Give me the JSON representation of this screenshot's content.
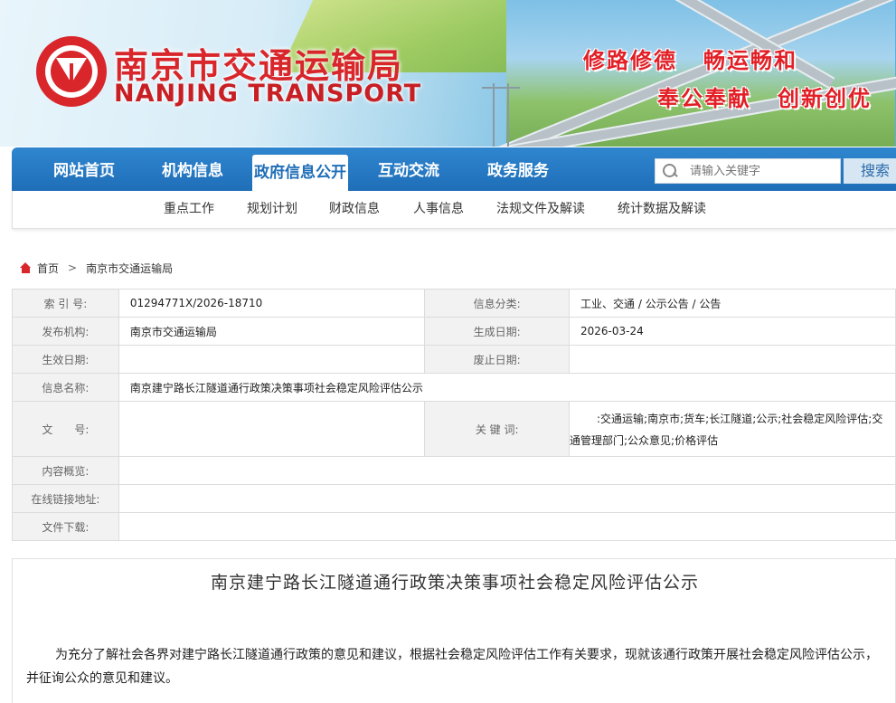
{
  "header": {
    "title_cn": "南京市交通运输局",
    "title_en": "NANJING TRANSPORT",
    "slogans": [
      "修路修德",
      "畅运畅和",
      "奉公奉献",
      "创新创优"
    ]
  },
  "nav": {
    "items": [
      "网站首页",
      "机构信息",
      "政府信息公开",
      "互动交流",
      "政务服务"
    ],
    "active_index": 2,
    "search_placeholder": "请输入关键字",
    "search_button": "搜索"
  },
  "subnav": [
    "重点工作",
    "规划计划",
    "财政信息",
    "人事信息",
    "法规文件及解读",
    "统计数据及解读"
  ],
  "breadcrumb": [
    "首页",
    "南京市交通运输局"
  ],
  "info": {
    "index_label": "索 引 号:",
    "index_value": "01294771X/2026-18710",
    "category_label": "信息分类:",
    "category_value": "工业、交通 / 公示公告 / 公告",
    "publisher_label": "发布机构:",
    "publisher_value": "南京市交通运输局",
    "created_label": "生成日期:",
    "created_value": "2026-03-24",
    "effective_label": "生效日期:",
    "effective_value": "",
    "abolish_label": "废止日期:",
    "abolish_value": "",
    "name_label": "信息名称:",
    "name_value": "南京建宁路长江隧道通行政策决策事项社会稳定风险评估公示",
    "docno_label": "文　　号:",
    "docno_value": "",
    "keywords_label": "关 键 词:",
    "keywords_line1": ":交通运输;南京市;货车;长江隧道;公示;社会稳定风险评估;交",
    "keywords_line2": "通管理部门;公众意见;价格评估",
    "summary_label": "内容概览:",
    "summary_value": "",
    "link_label": "在线链接地址:",
    "link_value": "",
    "download_label": "文件下载:",
    "download_value": ""
  },
  "article": {
    "title": "南京建宁路长江隧道通行政策决策事项社会稳定风险评估公示",
    "paragraph": "为充分了解社会各界对建宁路长江隧道通行政策的意见和建议，根据社会稳定风险评估工作有关要求，现就该通行政策开展社会稳定风险评估公示，并征询公众的意见和建议。"
  },
  "colors": {
    "brand_red": "#d8262b",
    "nav_blue": "#1f6eb8"
  }
}
